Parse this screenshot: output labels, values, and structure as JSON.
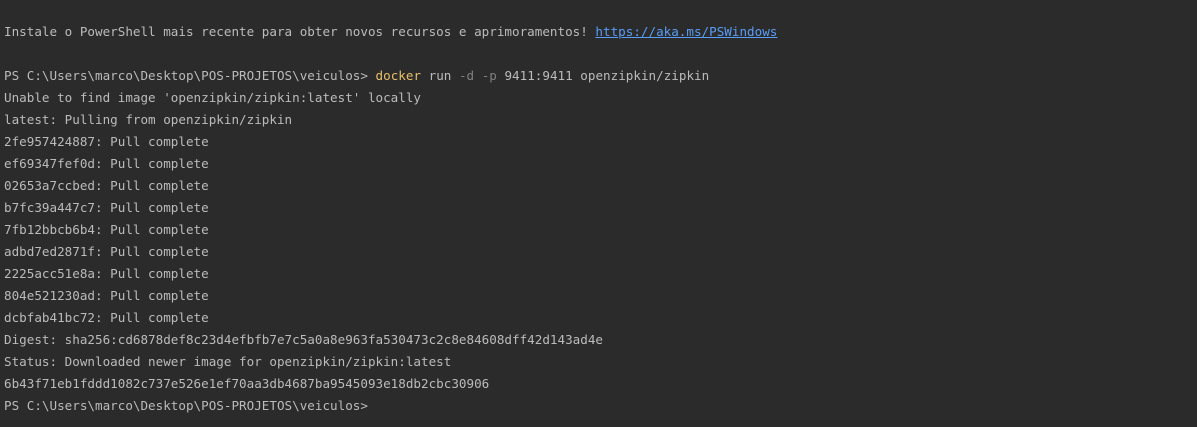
{
  "terminal": {
    "banner": {
      "text": "Instale o PowerShell mais recente para obter novos recursos e aprimoramentos! ",
      "link": "https://aka.ms/PSWindows"
    },
    "prompt": "PS C:\\Users\\marco\\Desktop\\POS-PROJETOS\\veiculos> ",
    "command": {
      "exe": "docker",
      "sub": " run ",
      "flag1": "-d",
      "sp1": " ",
      "flag2": "-p",
      "args": " 9411:9411 openzipkin/zipkin"
    },
    "output": [
      "Unable to find image 'openzipkin/zipkin:latest' locally",
      "latest: Pulling from openzipkin/zipkin",
      "2fe957424887: Pull complete",
      "ef69347fef0d: Pull complete",
      "02653a7ccbed: Pull complete",
      "b7fc39a447c7: Pull complete",
      "7fb12bbcb6b4: Pull complete",
      "adbd7ed2871f: Pull complete",
      "2225acc51e8a: Pull complete",
      "804e521230ad: Pull complete",
      "dcbfab41bc72: Pull complete",
      "Digest: sha256:cd6878def8c23d4efbfb7e7c5a0a8e963fa530473c2c8e84608dff42d143ad4e",
      "Status: Downloaded newer image for openzipkin/zipkin:latest",
      "6b43f71eb1fddd1082c737e526e1ef70aa3db4687ba9545093e18db2cbc30906"
    ],
    "final_prompt": "PS C:\\Users\\marco\\Desktop\\POS-PROJETOS\\veiculos>"
  }
}
